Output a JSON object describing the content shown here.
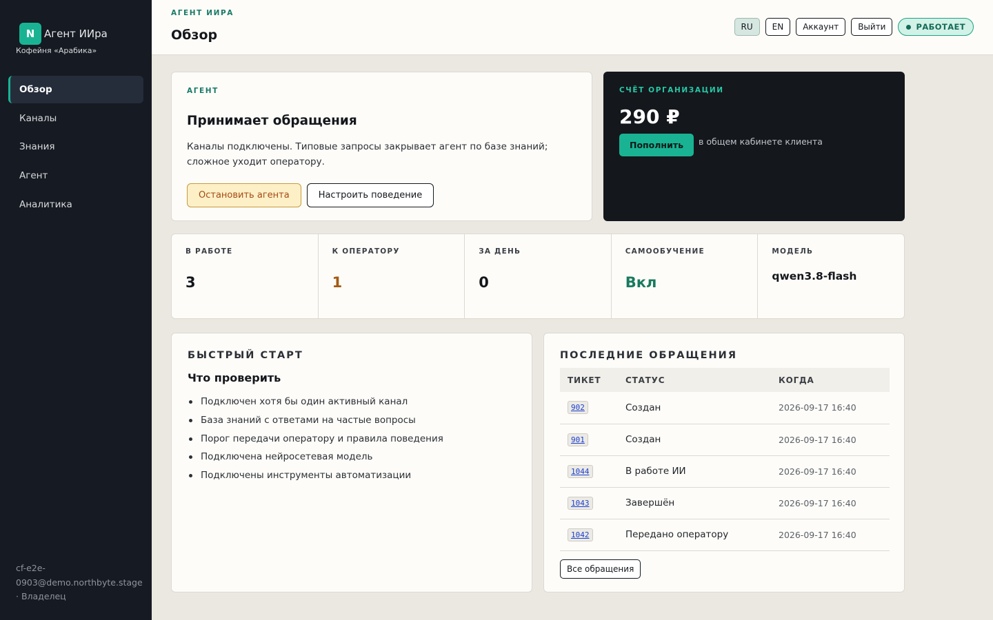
{
  "brand": {
    "logo_letter": "N",
    "name": "Агент ИИра",
    "subtitle": "Кофейня «Арабика»"
  },
  "nav": [
    {
      "label": "Обзор",
      "active": true
    },
    {
      "label": "Каналы",
      "active": false
    },
    {
      "label": "Знания",
      "active": false
    },
    {
      "label": "Агент",
      "active": false
    },
    {
      "label": "Аналитика",
      "active": false
    }
  ],
  "user": {
    "info": "cf-e2e-0903@demo.northbyte.stage · Владелец"
  },
  "header": {
    "kicker": "АГЕНТ ИИРА",
    "title": "Обзор",
    "lang_ru": "RU",
    "lang_en": "EN",
    "account": "Аккаунт",
    "logout": "Выйти",
    "status": "РАБОТАЕТ"
  },
  "agent": {
    "kicker": "АГЕНТ",
    "title": "Принимает обращения",
    "description": "Каналы подключены. Типовые запросы закрывает агент по базе знаний; сложное уходит оператору.",
    "stop_label": "Остановить агента",
    "configure_label": "Настроить поведение"
  },
  "balance": {
    "kicker": "СЧЁТ ОРГАНИЗАЦИИ",
    "amount": "290 ₽",
    "topup_label": "Пополнить",
    "note": "в общем кабинете клиента"
  },
  "stats": [
    {
      "label": "В РАБОТЕ",
      "value": "3"
    },
    {
      "label": "К ОПЕРАТОРУ",
      "value": "1"
    },
    {
      "label": "ЗА ДЕНЬ",
      "value": "0"
    },
    {
      "label": "САМООБУЧЕНИЕ",
      "value": "Вкл"
    },
    {
      "label": "МОДЕЛЬ",
      "value": "qwen3.8-flash"
    }
  ],
  "colors": {
    "accent": "#19b394",
    "warning": "#a35a14",
    "success": "#187a5e"
  },
  "quick": {
    "title": "БЫСТРЫЙ СТАРТ",
    "subtitle": "Что проверить",
    "items": [
      "Подключен хотя бы один активный канал",
      "База знаний с ответами на частые вопросы",
      "Порог передачи оператору и правила поведения",
      "Подключена нейросетевая модель",
      "Подключены инструменты автоматизации"
    ]
  },
  "recent": {
    "title": "ПОСЛЕДНИЕ ОБРАЩЕНИЯ",
    "columns": [
      "ТИКЕТ",
      "СТАТУС",
      "КОГДА"
    ],
    "rows": [
      {
        "ticket": "902",
        "status": "Создан",
        "when": "2026-09-17 16:40"
      },
      {
        "ticket": "901",
        "status": "Создан",
        "when": "2026-09-17 16:40"
      },
      {
        "ticket": "1044",
        "status": "В работе ИИ",
        "when": "2026-09-17 16:40"
      },
      {
        "ticket": "1043",
        "status": "Завершён",
        "when": "2026-09-17 16:40"
      },
      {
        "ticket": "1042",
        "status": "Передано оператору",
        "when": "2026-09-17 16:40"
      }
    ],
    "all_label": "Все обращения"
  }
}
